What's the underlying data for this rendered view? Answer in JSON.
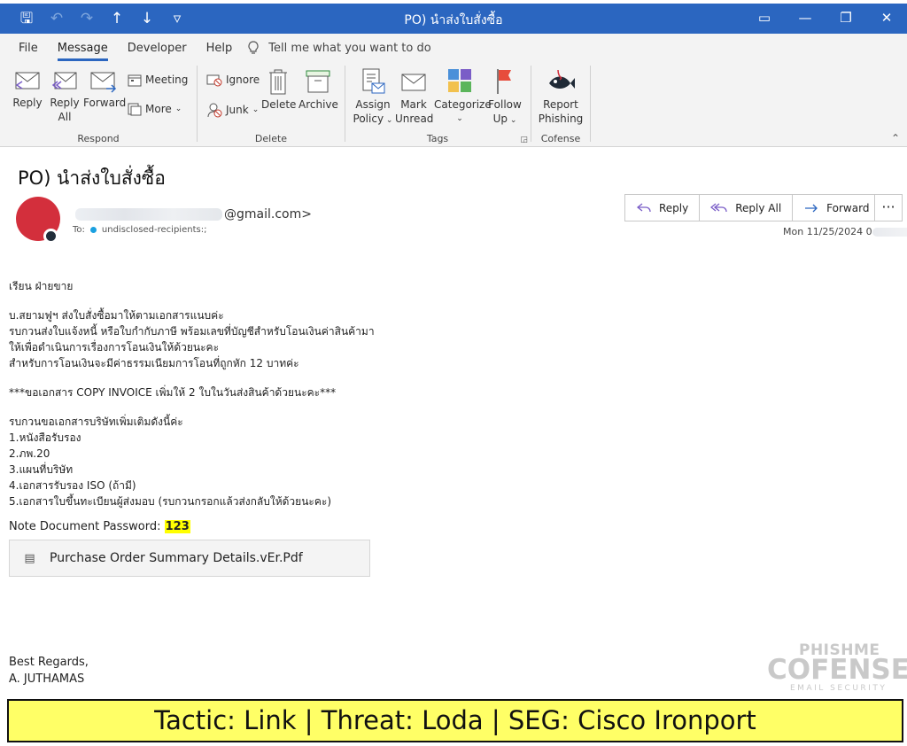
{
  "window": {
    "title": "PO) นำส่งใบสั่งซื้อ",
    "qat": {
      "save": "🖫",
      "undo": "↶",
      "redo": "↷",
      "up": "↑",
      "down": "↓",
      "customize": "▿"
    },
    "controls": {
      "ribbon_display": "▭",
      "minimize": "—",
      "restore": "❐",
      "close": "✕"
    }
  },
  "tabs": [
    {
      "label": "File"
    },
    {
      "label": "Message"
    },
    {
      "label": "Developer"
    },
    {
      "label": "Help"
    }
  ],
  "tell_me": "Tell me what you want to do",
  "ribbon": {
    "respond": {
      "label": "Respond",
      "reply": "Reply",
      "reply_all_1": "Reply",
      "reply_all_2": "All",
      "forward": "Forward",
      "meeting": "Meeting",
      "more": "More"
    },
    "delete": {
      "label": "Delete",
      "ignore": "Ignore",
      "junk": "Junk",
      "delete": "Delete",
      "archive": "Archive"
    },
    "tags": {
      "label": "Tags",
      "assign_1": "Assign",
      "assign_2": "Policy",
      "mark_1": "Mark",
      "mark_2": "Unread",
      "categorize": "Categorize",
      "follow_1": "Follow",
      "follow_2": "Up"
    },
    "cofense": {
      "label": "Cofense",
      "report_1": "Report",
      "report_2": "Phishing"
    }
  },
  "message": {
    "subject": "PO) นำส่งใบสั่งซื้อ",
    "sender_domain": "@gmail.com>",
    "to_label": "To:",
    "to_value": "undisclosed-recipients:;",
    "date": "Mon 11/25/2024 0",
    "actions": {
      "reply": "Reply",
      "reply_all": "Reply All",
      "forward": "Forward",
      "more": "···"
    },
    "body": [
      "เรียน ฝ่ายขาย",
      "",
      "บ.สยามฟูฯ ส่งใบสั่งซื้อมาให้ตามเอกสารแนบค่ะ",
      "รบกวนส่งใบแจ้งหนี้ หรือใบกำกับภาษี พร้อมเลขที่บัญชีสำหรับโอนเงินค่าสินค้ามา",
      "ให้เพื่อดำเนินการเรื่องการโอนเงินให้ด้วยนะคะ",
      "สำหรับการโอนเงินจะมีค่าธรรมเนียมการโอนที่ถูกหัก 12 บาทค่ะ",
      "",
      "***ขอเอกสาร COPY INVOICE เพิ่มให้ 2 ใบในวันส่งสินค้าด้วยนะคะ***",
      "",
      "รบกวนขอเอกสารบริษัทเพิ่มเติมดังนี้ค่ะ",
      "1.หนังสือรับรอง",
      "2.ภพ.20",
      "3.แผนที่บริษัท",
      "4.เอกสารรับรอง ISO (ถ้ามี)",
      "5.เอกสารใบขึ้นทะเบียนผู้ส่งมอบ (รบกวนกรอกแล้วส่งกลับให้ด้วยนะคะ)"
    ],
    "password_label": "Note Document Password:",
    "password_value": "123",
    "attachment": "Purchase Order Summary Details.vEr.Pdf",
    "regards_1": "Best Regards,",
    "regards_2": "A. JUTHAMAS"
  },
  "logo": {
    "top": "PHISHME",
    "main": "COFENSE",
    "sub": "EMAIL SECURITY"
  },
  "banner": "Tactic: Link | Threat: Loda | SEG: Cisco Ironport"
}
